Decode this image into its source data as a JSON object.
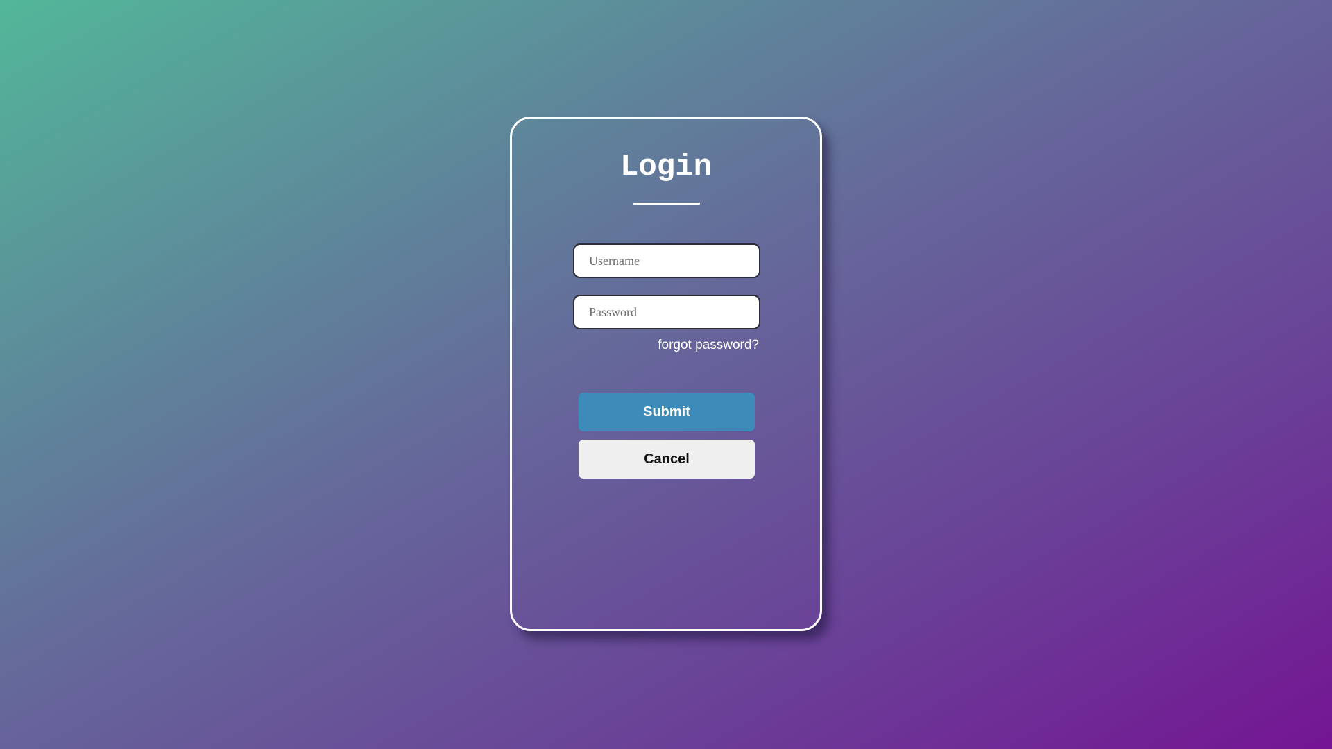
{
  "login": {
    "title": "Login",
    "username_placeholder": "Username",
    "password_placeholder": "Password",
    "forgot_label": "forgot password?",
    "submit_label": "Submit",
    "cancel_label": "Cancel"
  },
  "colors": {
    "background_start": "#52b799",
    "background_end": "#741593",
    "submit_button": "#3d8bb8",
    "cancel_button": "#efefef",
    "card_border": "#ffffff"
  }
}
